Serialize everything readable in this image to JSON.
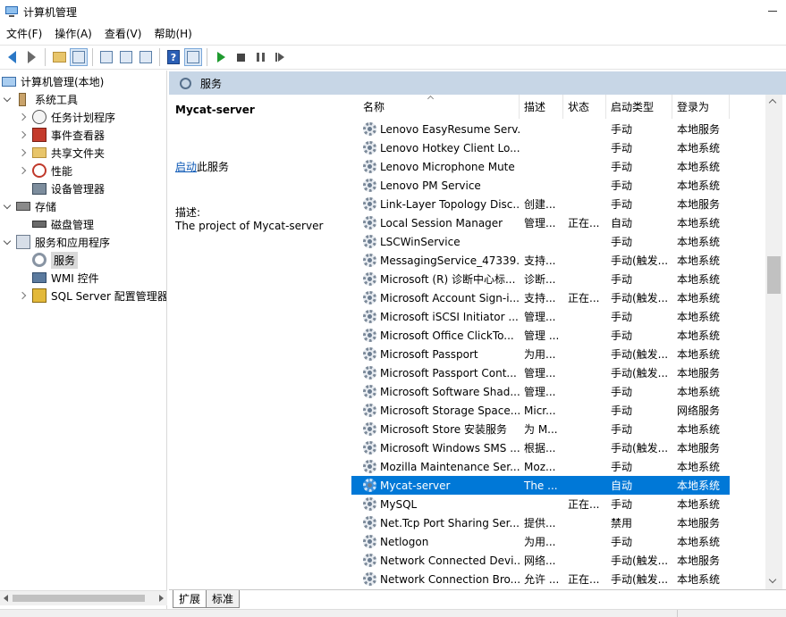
{
  "window": {
    "title": "计算机管理"
  },
  "menu": [
    "文件(F)",
    "操作(A)",
    "查看(V)",
    "帮助(H)"
  ],
  "tree": [
    {
      "label": "计算机管理(本地)",
      "level": 0,
      "expander": "none",
      "icon": "computer-icon"
    },
    {
      "label": "系统工具",
      "level": 1,
      "expander": "open",
      "icon": "tools-icon"
    },
    {
      "label": "任务计划程序",
      "level": 2,
      "expander": "closed",
      "icon": "clock-icon"
    },
    {
      "label": "事件查看器",
      "level": 2,
      "expander": "closed",
      "icon": "event-viewer-icon"
    },
    {
      "label": "共享文件夹",
      "level": 2,
      "expander": "closed",
      "icon": "shared-folder-icon"
    },
    {
      "label": "性能",
      "level": 2,
      "expander": "closed",
      "icon": "performance-icon"
    },
    {
      "label": "设备管理器",
      "level": 2,
      "expander": "none",
      "icon": "device-manager-icon"
    },
    {
      "label": "存储",
      "level": 1,
      "expander": "open",
      "icon": "storage-icon"
    },
    {
      "label": "磁盘管理",
      "level": 2,
      "expander": "none",
      "icon": "disk-icon"
    },
    {
      "label": "服务和应用程序",
      "level": 1,
      "expander": "open",
      "icon": "services-apps-icon"
    },
    {
      "label": "服务",
      "level": 2,
      "expander": "none",
      "icon": "services-icon",
      "selected": true
    },
    {
      "label": "WMI 控件",
      "level": 2,
      "expander": "none",
      "icon": "wmi-icon"
    },
    {
      "label": "SQL Server 配置管理器",
      "level": 2,
      "expander": "closed",
      "icon": "sql-server-icon"
    }
  ],
  "banner": {
    "title": "服务"
  },
  "details": {
    "service_name": "Mycat-server",
    "start_link": "启动",
    "start_suffix": "此服务",
    "desc_label": "描述:",
    "desc_text": "The project of Mycat-server"
  },
  "columns": {
    "name": "名称",
    "desc": "描述",
    "status": "状态",
    "startup": "启动类型",
    "logon": "登录为"
  },
  "services": [
    {
      "name": "Lenovo EasyResume Serv...",
      "desc": "",
      "status": "",
      "startup": "手动",
      "logon": "本地服务"
    },
    {
      "name": "Lenovo Hotkey Client Lo...",
      "desc": "",
      "status": "",
      "startup": "手动",
      "logon": "本地系统"
    },
    {
      "name": "Lenovo Microphone Mute",
      "desc": "",
      "status": "",
      "startup": "手动",
      "logon": "本地系统"
    },
    {
      "name": "Lenovo PM Service",
      "desc": "",
      "status": "",
      "startup": "手动",
      "logon": "本地系统"
    },
    {
      "name": "Link-Layer Topology Disc...",
      "desc": "创建...",
      "status": "",
      "startup": "手动",
      "logon": "本地服务"
    },
    {
      "name": "Local Session Manager",
      "desc": "管理...",
      "status": "正在...",
      "startup": "自动",
      "logon": "本地系统"
    },
    {
      "name": "LSCWinService",
      "desc": "",
      "status": "",
      "startup": "手动",
      "logon": "本地系统"
    },
    {
      "name": "MessagingService_47339...",
      "desc": "支持...",
      "status": "",
      "startup": "手动(触发...",
      "logon": "本地系统"
    },
    {
      "name": "Microsoft (R) 诊断中心标...",
      "desc": "诊断...",
      "status": "",
      "startup": "手动",
      "logon": "本地系统"
    },
    {
      "name": "Microsoft Account Sign-i...",
      "desc": "支持...",
      "status": "正在...",
      "startup": "手动(触发...",
      "logon": "本地系统"
    },
    {
      "name": "Microsoft iSCSI Initiator ...",
      "desc": "管理...",
      "status": "",
      "startup": "手动",
      "logon": "本地系统"
    },
    {
      "name": "Microsoft Office ClickTo...",
      "desc": "管理 ...",
      "status": "",
      "startup": "手动",
      "logon": "本地系统"
    },
    {
      "name": "Microsoft Passport",
      "desc": "为用...",
      "status": "",
      "startup": "手动(触发...",
      "logon": "本地系统"
    },
    {
      "name": "Microsoft Passport Cont...",
      "desc": "管理...",
      "status": "",
      "startup": "手动(触发...",
      "logon": "本地服务"
    },
    {
      "name": "Microsoft Software Shad...",
      "desc": "管理...",
      "status": "",
      "startup": "手动",
      "logon": "本地系统"
    },
    {
      "name": "Microsoft Storage Space...",
      "desc": "Micr...",
      "status": "",
      "startup": "手动",
      "logon": "网络服务"
    },
    {
      "name": "Microsoft Store 安装服务",
      "desc": "为 M...",
      "status": "",
      "startup": "手动",
      "logon": "本地系统"
    },
    {
      "name": "Microsoft Windows SMS ...",
      "desc": "根据...",
      "status": "",
      "startup": "手动(触发...",
      "logon": "本地服务"
    },
    {
      "name": "Mozilla Maintenance Ser...",
      "desc": "Moz...",
      "status": "",
      "startup": "手动",
      "logon": "本地系统"
    },
    {
      "name": "Mycat-server",
      "desc": "The ...",
      "status": "",
      "startup": "自动",
      "logon": "本地系统",
      "selected": true
    },
    {
      "name": "MySQL",
      "desc": "",
      "status": "正在...",
      "startup": "手动",
      "logon": "本地系统"
    },
    {
      "name": "Net.Tcp Port Sharing Ser...",
      "desc": "提供...",
      "status": "",
      "startup": "禁用",
      "logon": "本地服务"
    },
    {
      "name": "Netlogon",
      "desc": "为用...",
      "status": "",
      "startup": "手动",
      "logon": "本地系统"
    },
    {
      "name": "Network Connected Devi...",
      "desc": "网络...",
      "status": "",
      "startup": "手动(触发...",
      "logon": "本地服务"
    },
    {
      "name": "Network Connection Bro...",
      "desc": "允许 ...",
      "status": "正在...",
      "startup": "手动(触发...",
      "logon": "本地系统"
    }
  ],
  "tabs": {
    "extended": "扩展",
    "standard": "标准"
  },
  "colors": {
    "selection": "#0078d7",
    "banner": "#c7d6e6",
    "link": "#0b57b5"
  }
}
